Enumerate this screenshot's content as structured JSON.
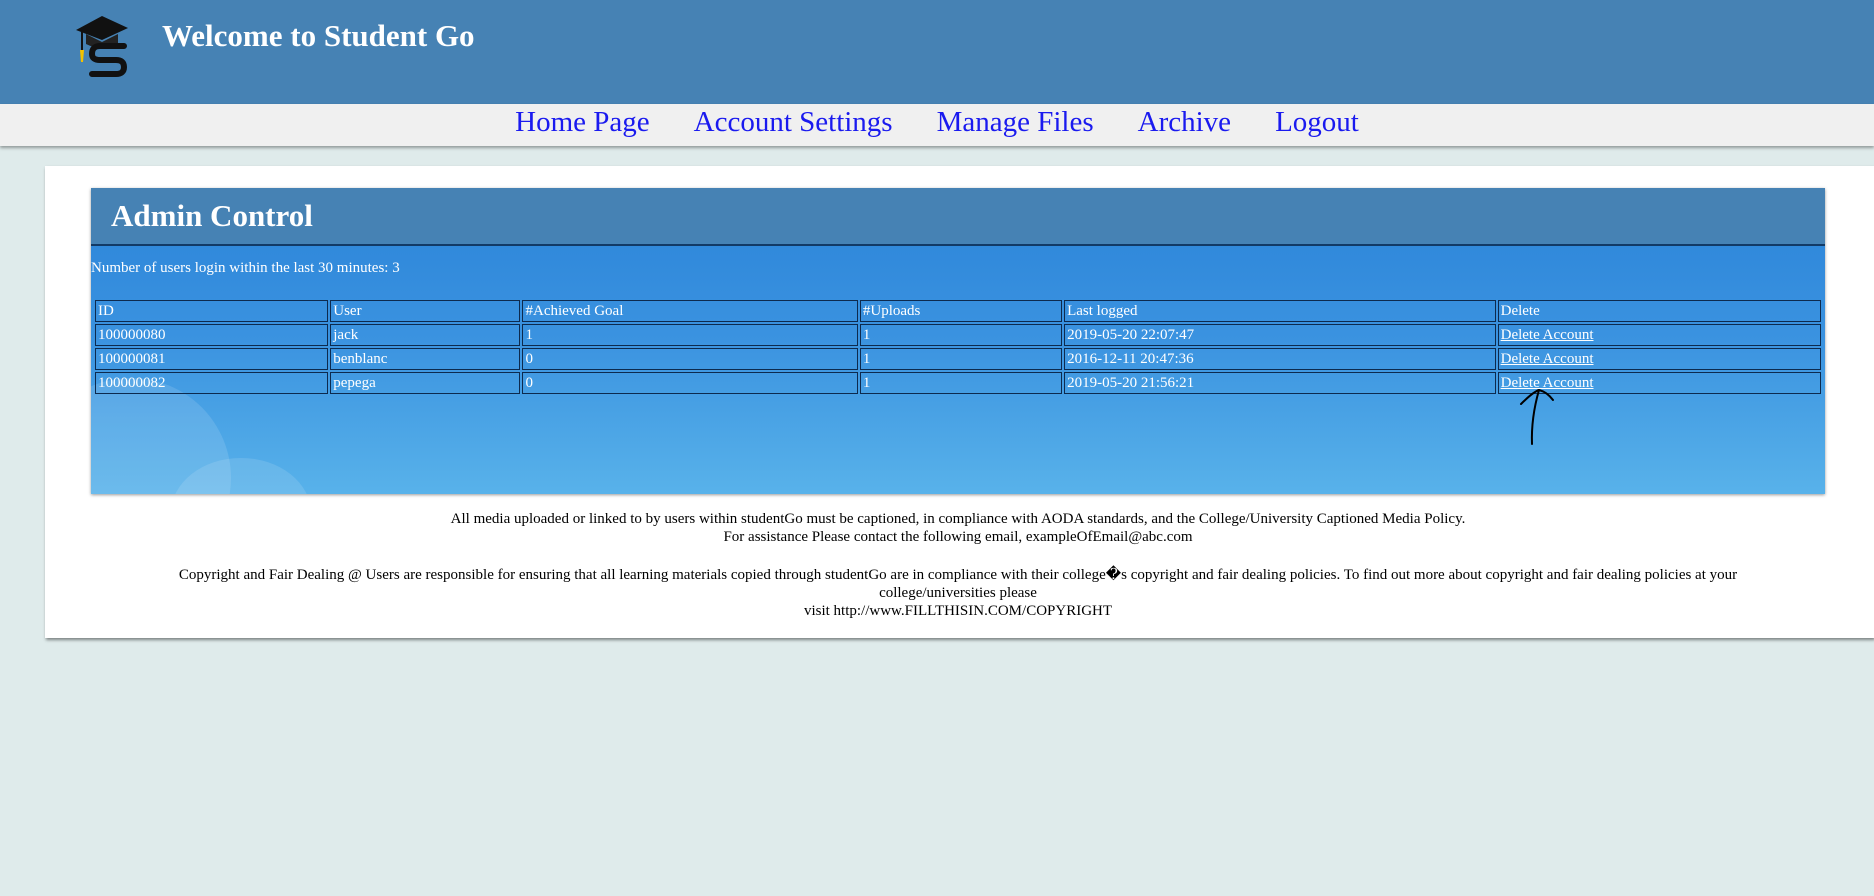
{
  "header": {
    "title": "Welcome to Student Go",
    "logo_icon": "graduation-cap-s-logo-icon"
  },
  "nav": {
    "items": [
      "Home Page",
      "Account Settings",
      "Manage Files",
      "Archive",
      "Logout"
    ]
  },
  "admin": {
    "title": "Admin Control",
    "users_login_text": "Number of users login within the last 30 minutes: 3",
    "columns": [
      "ID",
      "User",
      "#Achieved Goal",
      "#Uploads",
      "Last logged",
      "Delete"
    ],
    "rows": [
      {
        "id": "100000080",
        "user": "jack",
        "achieved": "1",
        "uploads": "1",
        "last_logged": "2019-05-20 22:07:47",
        "delete": "Delete Account"
      },
      {
        "id": "100000081",
        "user": "benblanc",
        "achieved": "0",
        "uploads": "1",
        "last_logged": "2016-12-11 20:47:36",
        "delete": "Delete Account"
      },
      {
        "id": "100000082",
        "user": "pepega",
        "achieved": "0",
        "uploads": "1",
        "last_logged": "2019-05-20 21:56:21",
        "delete": "Delete Account"
      }
    ]
  },
  "footer": {
    "media_line": "All media uploaded or linked to by users within studentGo must be captioned, in compliance with AODA standards, and the College/University Captioned Media Policy.",
    "assist_line": "For assistance Please contact the following email, exampleOfEmail@abc.com",
    "copyright_line": "Copyright and Fair Dealing @ Users are responsible for ensuring that all learning materials copied through studentGo are in compliance with their college�s copyright and fair dealing policies. To find out more about copyright and fair dealing policies at your college/universities please",
    "visit_line": "visit http://www.FILLTHISIN.COM/COPYRIGHT"
  },
  "colors": {
    "header_bg": "#4682b4",
    "nav_link": "#1a1aef",
    "page_bg": "#dfebeb",
    "admin_panel": "#2a83d8"
  }
}
